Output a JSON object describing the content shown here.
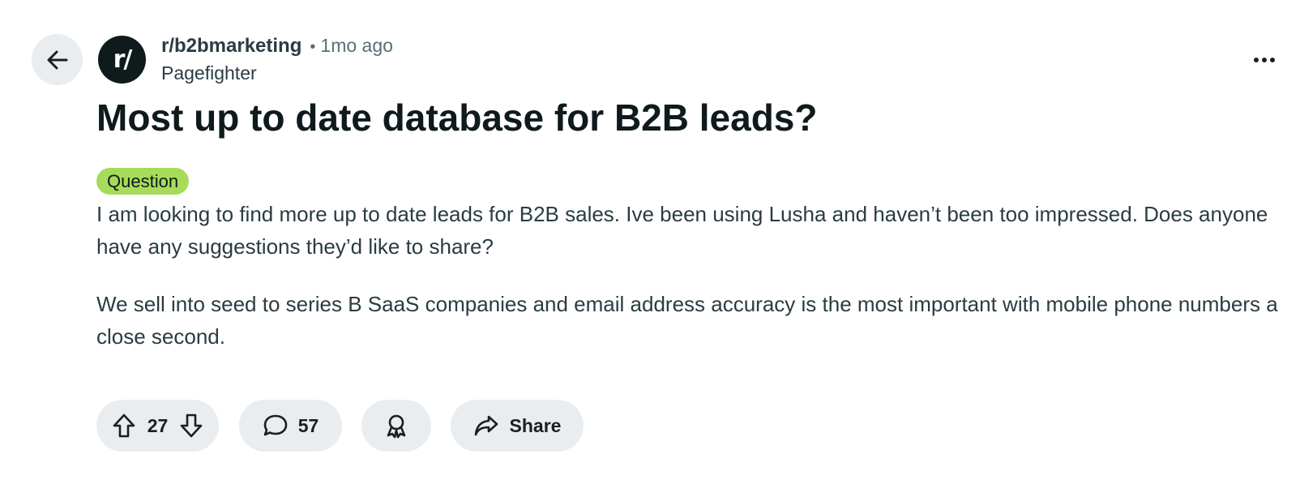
{
  "post": {
    "subreddit": "r/b2bmarketing",
    "separator": "•",
    "time_ago": "1mo ago",
    "author": "Pagefighter",
    "avatar_text": "r/",
    "title": "Most up to date database for B2B leads?",
    "flair": "Question",
    "flair_color": "#a6dc5a",
    "body": [
      "I am looking to find more up to date leads for B2B sales. Ive been using Lusha and haven’t been too impressed. Does anyone have any suggestions they’d like to share?",
      "We sell into seed to series B SaaS companies and email address accuracy is the most important with mobile phone numbers a close second."
    ]
  },
  "actions": {
    "vote_count": "27",
    "comment_count": "57",
    "share_label": "Share"
  },
  "icons": {
    "back": "arrow-left-icon",
    "more": "ellipsis-icon",
    "upvote": "arrow-up-icon",
    "downvote": "arrow-down-icon",
    "comment": "speech-bubble-icon",
    "award": "award-ribbon-icon",
    "share": "share-arrow-icon"
  }
}
